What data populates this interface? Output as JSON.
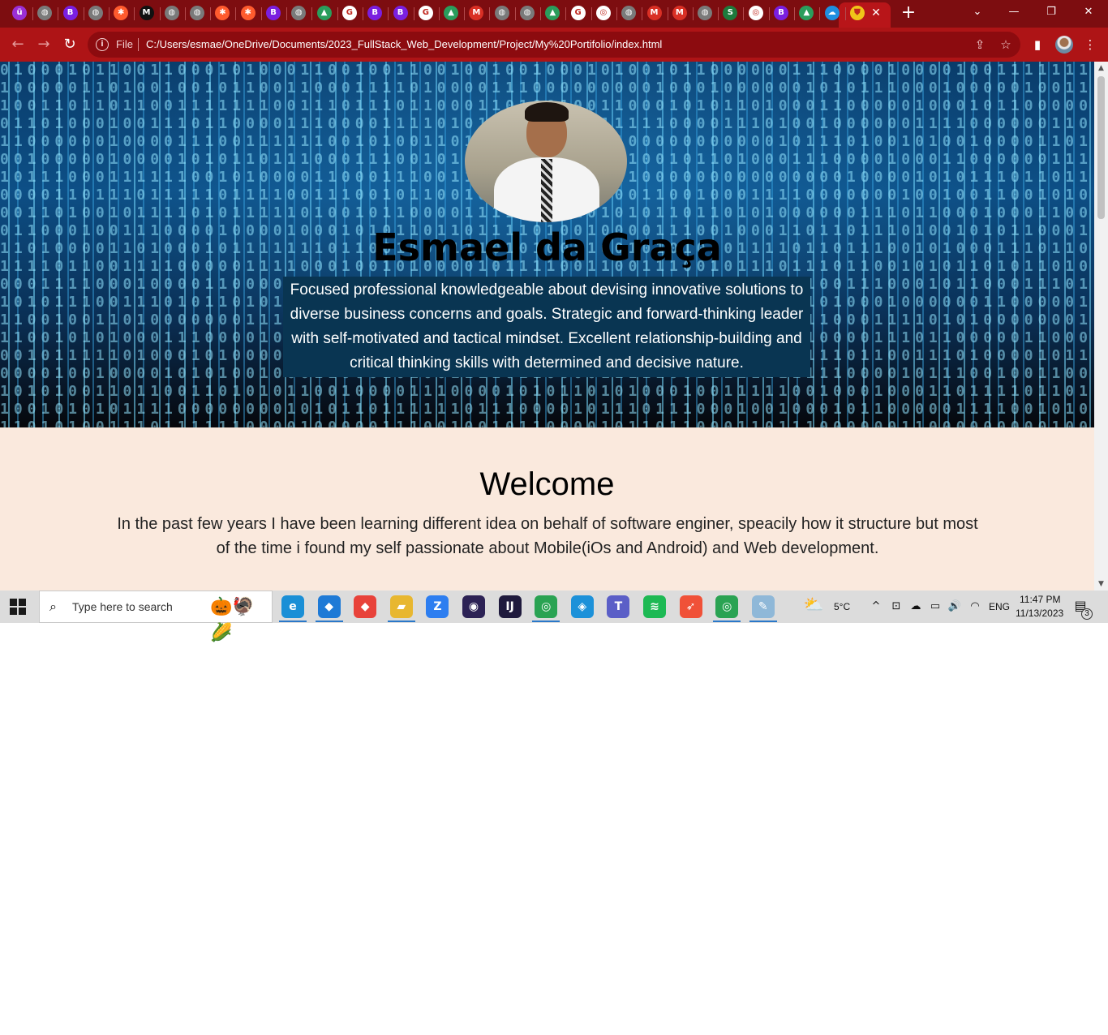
{
  "browser": {
    "tabs": [
      {
        "icon": "purple-u-icon",
        "glyph": "ü",
        "color": "#9b2fd6"
      },
      {
        "icon": "globe-icon",
        "glyph": "◍",
        "color": "#7a7a7a"
      },
      {
        "icon": "bootstrap-icon",
        "glyph": "B",
        "color": "#7a1fe0"
      },
      {
        "icon": "globe-icon",
        "glyph": "◍",
        "color": "#7a7a7a"
      },
      {
        "icon": "asterisk-icon",
        "glyph": "✱",
        "color": "#ff5b2e"
      },
      {
        "icon": "medium-icon",
        "glyph": "M",
        "color": "#111111"
      },
      {
        "icon": "globe-icon",
        "glyph": "◍",
        "color": "#7a7a7a"
      },
      {
        "icon": "globe-icon",
        "glyph": "◍",
        "color": "#7a7a7a"
      },
      {
        "icon": "asterisk-icon",
        "glyph": "✱",
        "color": "#ff5b2e"
      },
      {
        "icon": "asterisk-icon",
        "glyph": "✱",
        "color": "#ff5b2e"
      },
      {
        "icon": "bootstrap-icon",
        "glyph": "B",
        "color": "#7a1fe0"
      },
      {
        "icon": "globe-icon",
        "glyph": "◍",
        "color": "#7a7a7a"
      },
      {
        "icon": "drive-icon",
        "glyph": "▲",
        "color": "#2a9d5c"
      },
      {
        "icon": "google-icon",
        "glyph": "G",
        "color": "#ffffff"
      },
      {
        "icon": "bootstrap-icon",
        "glyph": "B",
        "color": "#7a1fe0"
      },
      {
        "icon": "bootstrap-icon",
        "glyph": "B",
        "color": "#7a1fe0"
      },
      {
        "icon": "google-icon",
        "glyph": "G",
        "color": "#ffffff"
      },
      {
        "icon": "drive-icon",
        "glyph": "▲",
        "color": "#2a9d5c"
      },
      {
        "icon": "gmail-icon",
        "glyph": "M",
        "color": "#d93025"
      },
      {
        "icon": "globe-icon",
        "glyph": "◍",
        "color": "#7a7a7a"
      },
      {
        "icon": "globe-icon",
        "glyph": "◍",
        "color": "#7a7a7a"
      },
      {
        "icon": "drive-icon",
        "glyph": "▲",
        "color": "#2a9d5c"
      },
      {
        "icon": "google-icon",
        "glyph": "G",
        "color": "#ffffff"
      },
      {
        "icon": "chrome-icon",
        "glyph": "◎",
        "color": "#ffffff"
      },
      {
        "icon": "globe-icon",
        "glyph": "◍",
        "color": "#7a7a7a"
      },
      {
        "icon": "gmail-icon",
        "glyph": "M",
        "color": "#d93025"
      },
      {
        "icon": "gmail-icon",
        "glyph": "M",
        "color": "#d93025"
      },
      {
        "icon": "globe-icon",
        "glyph": "◍",
        "color": "#7a7a7a"
      },
      {
        "icon": "s-icon",
        "glyph": "S",
        "color": "#1e7a3c"
      },
      {
        "icon": "chrome-icon",
        "glyph": "◎",
        "color": "#ffffff"
      },
      {
        "icon": "bootstrap-icon",
        "glyph": "B",
        "color": "#7a1fe0"
      },
      {
        "icon": "drive-icon",
        "glyph": "▲",
        "color": "#2a9d5c"
      },
      {
        "icon": "cloud-icon",
        "glyph": "☁",
        "color": "#1f8fe0"
      },
      {
        "icon": "shield-icon",
        "glyph": "⛊",
        "color": "#f0c419"
      }
    ],
    "active_tab_close": "✕",
    "new_tab": "+",
    "window_controls": {
      "dropdown": "⌄",
      "minimize": "—",
      "restore": "❐",
      "close": "✕"
    },
    "toolbar": {
      "back": "←",
      "forward": "→",
      "reload": "↻",
      "info": "i",
      "scheme_label": "File",
      "url": "C:/Users/esmae/OneDrive/Documents/2023_FullStack_Web_Development/Project/My%20Portifolio/index.html",
      "share": "⇪",
      "bookmark": "☆",
      "sidepanel": "▮",
      "menu": "⋮"
    }
  },
  "page": {
    "hero": {
      "name": "Esmael da Graça",
      "description": "Focused professional knowledgeable about devising innovative solutions to diverse business concerns and goals. Strategic and forward-thinking leader with self-motivated and tactical mindset. Excellent relationship-building and critical thinking skills with determined and decisive nature."
    },
    "welcome": {
      "heading": "Welcome",
      "text": "In the past few years I have been learning different idea on behalf of software enginer, speacily how it structure but most of the time i found my self passionate about Mobile(iOs and Android) and Web development."
    }
  },
  "scrollbar": {
    "up": "▲",
    "down": "▼",
    "position": 0.0
  },
  "taskbar": {
    "search_placeholder": "Type here to search",
    "search_glass": "⌕",
    "search_deco": "🎃🦃🌽",
    "apps": [
      {
        "icon": "edge-icon",
        "glyph": "e",
        "color": "#1a8fd6",
        "active": true
      },
      {
        "icon": "vscode-icon",
        "glyph": "◆",
        "color": "#1e7ad6",
        "active": true
      },
      {
        "icon": "git-icon",
        "glyph": "◆",
        "color": "#e8423a",
        "active": false
      },
      {
        "icon": "file-explorer-icon",
        "glyph": "▰",
        "color": "#e8b730",
        "active": true
      },
      {
        "icon": "zoom-icon",
        "glyph": "Z",
        "color": "#2d7ef0",
        "active": false
      },
      {
        "icon": "eclipse-icon",
        "glyph": "◉",
        "color": "#2c2255",
        "active": false
      },
      {
        "icon": "intellij-icon",
        "glyph": "IJ",
        "color": "#1f1a3d",
        "active": false
      },
      {
        "icon": "chrome-icon",
        "glyph": "◎",
        "color": "#2aa353",
        "active": true
      },
      {
        "icon": "docker-icon",
        "glyph": "◈",
        "color": "#1c91d9",
        "active": false
      },
      {
        "icon": "teams-icon",
        "glyph": "T",
        "color": "#5b5fc7",
        "active": false
      },
      {
        "icon": "spotify-icon",
        "glyph": "≋",
        "color": "#1db954",
        "active": false
      },
      {
        "icon": "swift-icon",
        "glyph": "➶",
        "color": "#f05138",
        "active": false
      },
      {
        "icon": "chrome-profile-icon",
        "glyph": "◎",
        "color": "#2aa353",
        "active": true
      },
      {
        "icon": "paint-icon",
        "glyph": "✎",
        "color": "#8fb8d8",
        "active": true
      }
    ],
    "weather_icon": "⛅",
    "temperature": "5°C",
    "tray": {
      "chevron": "^",
      "meet": "⊡",
      "onedrive": "☁",
      "battery": "▭",
      "volume": "🔊",
      "wifi": "◠",
      "language": "ENG",
      "time": "11:47 PM",
      "date": "11/13/2023",
      "notifications_icon": "▤",
      "notifications_count": "3"
    }
  }
}
